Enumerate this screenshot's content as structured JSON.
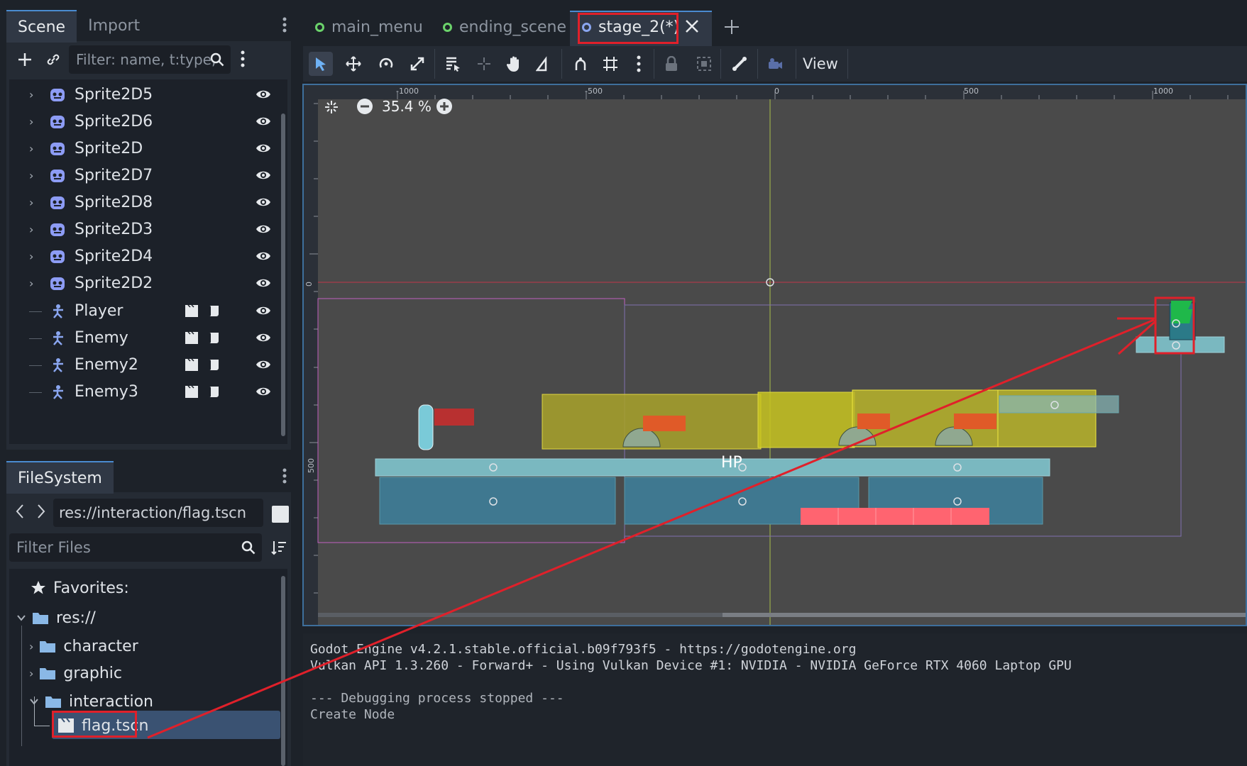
{
  "scene_dock": {
    "tabs": [
      "Scene",
      "Import"
    ],
    "filter_placeholder": "Filter: name, t:type,",
    "nodes": [
      {
        "label": "Sprite2D5",
        "type": "sprite"
      },
      {
        "label": "Sprite2D6",
        "type": "sprite"
      },
      {
        "label": "Sprite2D",
        "type": "sprite"
      },
      {
        "label": "Sprite2D7",
        "type": "sprite"
      },
      {
        "label": "Sprite2D8",
        "type": "sprite"
      },
      {
        "label": "Sprite2D3",
        "type": "sprite"
      },
      {
        "label": "Sprite2D4",
        "type": "sprite"
      },
      {
        "label": "Sprite2D2",
        "type": "sprite"
      },
      {
        "label": "Player",
        "type": "instance"
      },
      {
        "label": "Enemy",
        "type": "instance"
      },
      {
        "label": "Enemy2",
        "type": "instance"
      },
      {
        "label": "Enemy3",
        "type": "instance"
      }
    ]
  },
  "filesystem_dock": {
    "tab": "FileSystem",
    "path": "res://interaction/flag.tscn",
    "filter_placeholder": "Filter Files",
    "favorites_label": "Favorites:",
    "root_label": "res://",
    "folders": [
      "character",
      "graphic",
      "interaction"
    ],
    "selected_file": "flag.tscn"
  },
  "scene_tabs": [
    {
      "label": "main_menu",
      "state": "saved"
    },
    {
      "label": "ending_scene",
      "state": "saved"
    },
    {
      "label": "stage_2(*)",
      "state": "active"
    }
  ],
  "toolbar": {
    "view_label": "View"
  },
  "viewport": {
    "zoom_label": "35.4 %",
    "ruler_top_labels": [
      "-1000",
      "-500",
      "0",
      "500",
      "1000"
    ],
    "ruler_left_labels": [
      "0",
      "500"
    ],
    "hp_label": "HP"
  },
  "output": {
    "lines": [
      "Godot Engine v4.2.1.stable.official.b09f793f5 - https://godotengine.org",
      "Vulkan API 1.3.260 - Forward+ - Using Vulkan Device #1: NVIDIA - NVIDIA GeForce RTX 4060 Laptop GPU",
      "",
      "--- Debugging process stopped ---",
      "Create Node"
    ]
  },
  "colors": {
    "highlight": "#e0202a",
    "accent": "#4a8bd0",
    "sprite_icon": "#8d9cf5",
    "node_icon": "#8aa6f0"
  }
}
